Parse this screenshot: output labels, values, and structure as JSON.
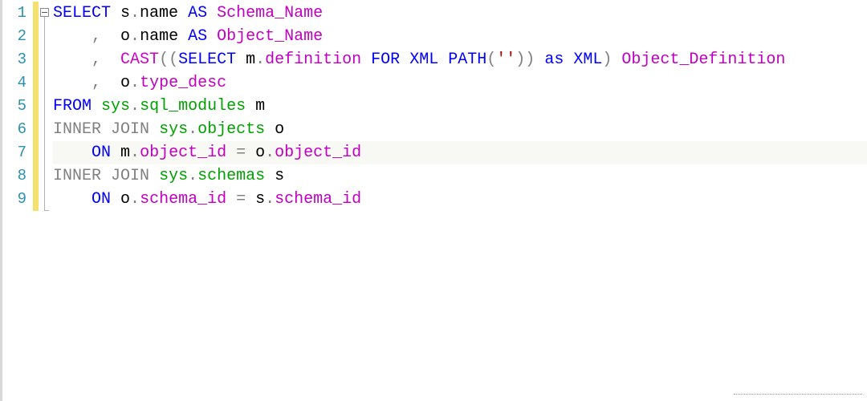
{
  "editor": {
    "lines": [
      {
        "n": "1",
        "html": "<span class='kw'>SELECT</span><span class='plain'> s</span><span class='op'>.</span><span class='plain'>name </span><span class='kw'>AS</span><span class='plain'> </span><span class='col'>Schema_Name</span>"
      },
      {
        "n": "2",
        "html": "<span class='plain'>    </span><span class='op'>,</span><span class='plain'>  o</span><span class='op'>.</span><span class='plain'>name </span><span class='kw'>AS</span><span class='plain'> </span><span class='col'>Object_Name</span>"
      },
      {
        "n": "3",
        "html": "<span class='plain'>    </span><span class='op'>,</span><span class='plain'>  </span><span class='func'>CAST</span><span class='op'>((</span><span class='kw'>SELECT</span><span class='plain'> m</span><span class='op'>.</span><span class='col'>definition</span><span class='plain'> </span><span class='kw'>FOR</span><span class='plain'> </span><span class='kw'>XML</span><span class='plain'> </span><span class='kw'>PATH</span><span class='op'>(</span><span class='str'>''</span><span class='op'>))</span><span class='plain'> </span><span class='kw'>as</span><span class='plain'> </span><span class='kw'>XML</span><span class='op'>)</span><span class='plain'> </span><span class='col'>Object_Definition</span>"
      },
      {
        "n": "4",
        "html": "<span class='plain'>    </span><span class='op'>,</span><span class='plain'>  o</span><span class='op'>.</span><span class='col'>type_desc</span>"
      },
      {
        "n": "5",
        "html": "<span class='kw'>FROM</span><span class='plain'> </span><span class='obj'>sys</span><span class='op'>.</span><span class='obj'>sql_modules</span><span class='plain'> m</span>"
      },
      {
        "n": "6",
        "html": "<span class='kw-gray'>INNER</span><span class='plain'> </span><span class='kw-gray'>JOIN</span><span class='plain'> </span><span class='obj'>sys</span><span class='op'>.</span><span class='obj'>objects</span><span class='plain'> o</span>"
      },
      {
        "n": "7",
        "html": "<span class='plain'>    </span><span class='kw'>ON</span><span class='plain'> m</span><span class='op'>.</span><span class='col'>object_id</span><span class='plain'> </span><span class='op'>=</span><span class='plain'> o</span><span class='op'>.</span><span class='col'>object_id</span>"
      },
      {
        "n": "8",
        "html": "<span class='kw-gray'>INNER</span><span class='plain'> </span><span class='kw-gray'>JOIN</span><span class='plain'> </span><span class='obj'>sys</span><span class='op'>.</span><span class='obj'>schemas</span><span class='plain'> s</span>"
      },
      {
        "n": "9",
        "html": "<span class='plain'>    </span><span class='kw'>ON</span><span class='plain'> o</span><span class='op'>.</span><span class='col'>schema_id</span><span class='plain'> </span><span class='op'>=</span><span class='plain'> s</span><span class='op'>.</span><span class='col'>schema_id</span>"
      }
    ],
    "current_line_index": 6,
    "raw_sql": "SELECT s.name AS Schema_Name\n    ,  o.name AS Object_Name\n    ,  CAST((SELECT m.definition FOR XML PATH('')) as XML) Object_Definition\n    ,  o.type_desc\nFROM sys.sql_modules m\nINNER JOIN sys.objects o\n    ON m.object_id = o.object_id\nINNER JOIN sys.schemas s\n    ON o.schema_id = s.schema_id"
  }
}
